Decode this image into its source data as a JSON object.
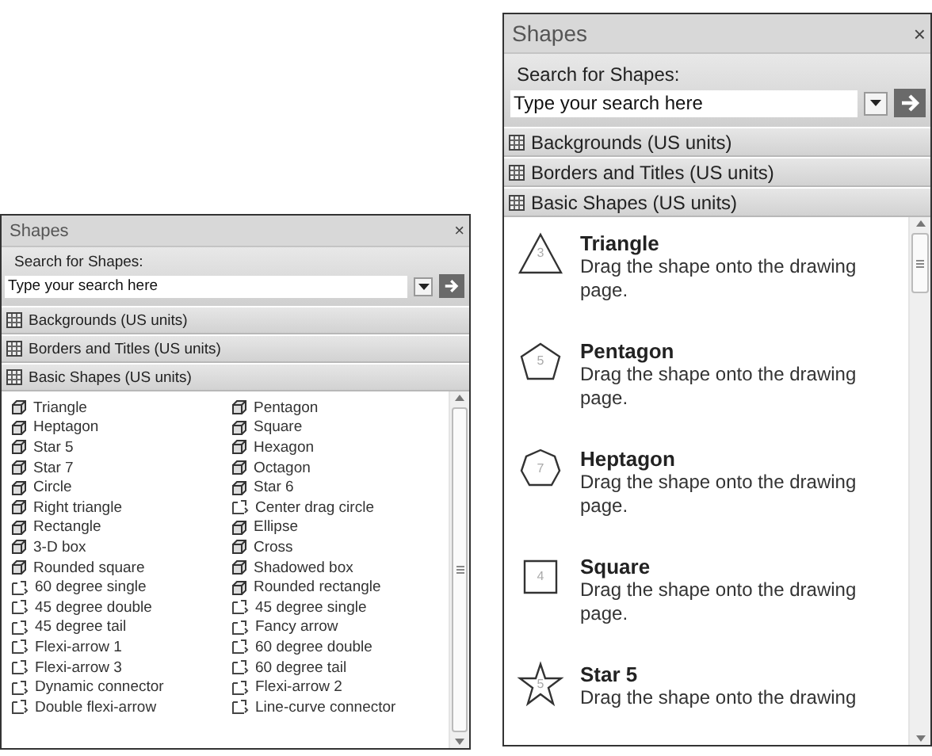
{
  "panels": [
    {
      "kind": "icons",
      "title": "Shapes",
      "close": "×",
      "search": {
        "label": "Search for Shapes:",
        "placeholder": "Type your search here"
      },
      "stencils": [
        {
          "label": "Backgrounds (US units)"
        },
        {
          "label": "Borders and Titles (US units)"
        },
        {
          "label": "Basic Shapes (US units)"
        }
      ],
      "shapes": [
        {
          "name": "Triangle",
          "kind": "shape"
        },
        {
          "name": "Pentagon",
          "kind": "shape"
        },
        {
          "name": "Heptagon",
          "kind": "shape"
        },
        {
          "name": "Square",
          "kind": "shape"
        },
        {
          "name": "Star 5",
          "kind": "shape"
        },
        {
          "name": "Hexagon",
          "kind": "shape"
        },
        {
          "name": "Star 7",
          "kind": "shape"
        },
        {
          "name": "Octagon",
          "kind": "shape"
        },
        {
          "name": "Circle",
          "kind": "shape"
        },
        {
          "name": "Star 6",
          "kind": "shape"
        },
        {
          "name": "Right triangle",
          "kind": "shape"
        },
        {
          "name": "Center drag circle",
          "kind": "connector"
        },
        {
          "name": "Rectangle",
          "kind": "shape"
        },
        {
          "name": "Ellipse",
          "kind": "shape"
        },
        {
          "name": "3-D box",
          "kind": "shape"
        },
        {
          "name": "Cross",
          "kind": "shape"
        },
        {
          "name": "Rounded square",
          "kind": "shape"
        },
        {
          "name": "Shadowed box",
          "kind": "shape"
        },
        {
          "name": "60 degree single",
          "kind": "connector"
        },
        {
          "name": "Rounded rectangle",
          "kind": "shape"
        },
        {
          "name": "45 degree double",
          "kind": "connector"
        },
        {
          "name": "45 degree single",
          "kind": "connector"
        },
        {
          "name": "45 degree tail",
          "kind": "connector"
        },
        {
          "name": "Fancy arrow",
          "kind": "connector"
        },
        {
          "name": "Flexi-arrow 1",
          "kind": "connector"
        },
        {
          "name": "60 degree double",
          "kind": "connector"
        },
        {
          "name": "Flexi-arrow 3",
          "kind": "connector"
        },
        {
          "name": "60 degree tail",
          "kind": "connector"
        },
        {
          "name": "Dynamic connector",
          "kind": "connector"
        },
        {
          "name": "Flexi-arrow 2",
          "kind": "connector"
        },
        {
          "name": "Double flexi-arrow",
          "kind": "connector"
        },
        {
          "name": "Line-curve connector",
          "kind": "connector"
        }
      ]
    },
    {
      "kind": "details",
      "title": "Shapes",
      "close": "×",
      "search": {
        "label": "Search for Shapes:",
        "placeholder": "Type your search here"
      },
      "stencils": [
        {
          "label": "Backgrounds (US units)"
        },
        {
          "label": "Borders and Titles (US units)"
        },
        {
          "label": "Basic Shapes (US units)"
        }
      ],
      "shapes": [
        {
          "name": "Triangle",
          "kind": "triangle",
          "number": "3",
          "description": "Drag the shape onto the drawing page."
        },
        {
          "name": "Pentagon",
          "kind": "pentagon",
          "number": "5",
          "description": "Drag the shape onto the drawing page."
        },
        {
          "name": "Heptagon",
          "kind": "heptagon",
          "number": "7",
          "description": "Drag the shape onto the drawing page."
        },
        {
          "name": "Square",
          "kind": "square",
          "number": "4",
          "description": "Drag the shape onto the drawing page."
        },
        {
          "name": "Star 5",
          "kind": "star",
          "number": "5",
          "description": "Drag the shape onto the drawing"
        }
      ]
    }
  ]
}
